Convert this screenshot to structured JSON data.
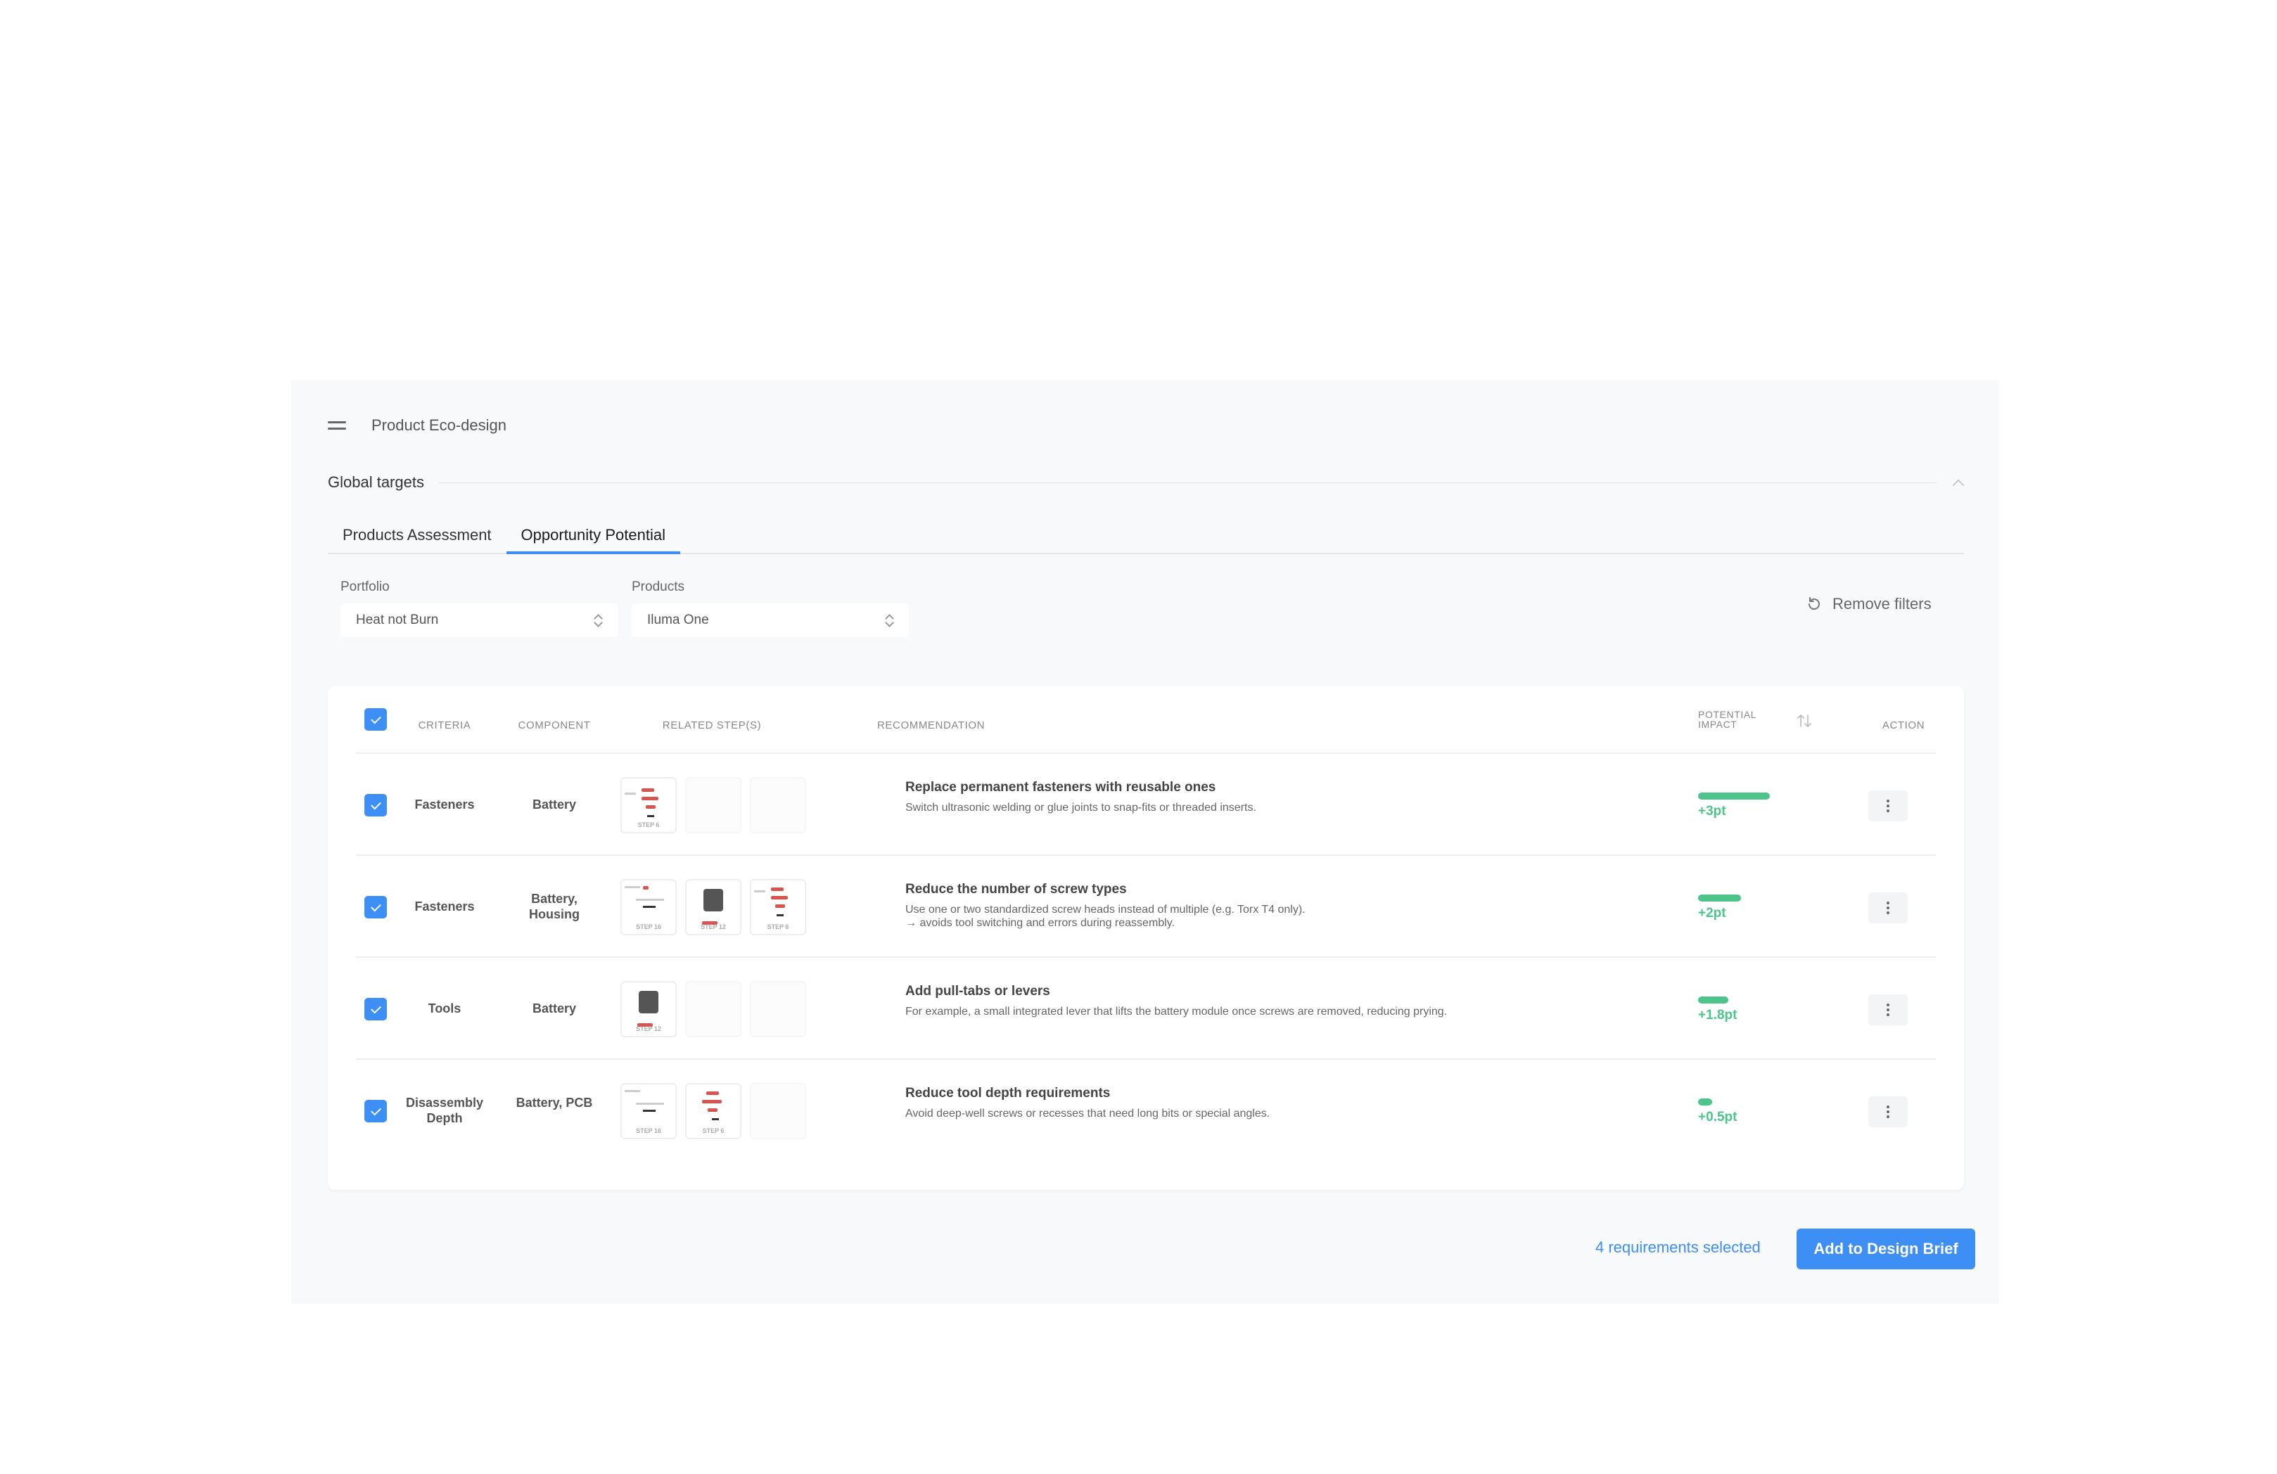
{
  "app": {
    "title": "Product Eco-design",
    "menu_icon": "hamburger-icon"
  },
  "section": {
    "title": "Global targets"
  },
  "tabs": [
    {
      "label": "Products Assessment",
      "active": false
    },
    {
      "label": "Opportunity Potential",
      "active": true
    }
  ],
  "filters": {
    "portfolio": {
      "label": "Portfolio",
      "value": "Heat not Burn"
    },
    "products": {
      "label": "Products",
      "value": "Iluma One"
    },
    "remove_label": "Remove filters"
  },
  "table": {
    "headers": {
      "criteria": "CRITERIA",
      "component": "COMPONENT",
      "steps": "RELATED STEP(S)",
      "recommendation": "RECOMMENDATION",
      "impact_line1": "POTENTIAL",
      "impact_line2": "IMPACT",
      "action": "ACTION"
    },
    "rows": [
      {
        "criteria": "Fasteners",
        "component": "Battery",
        "steps": [
          "STEP 6"
        ],
        "title": "Replace permanent fasteners with reusable ones",
        "desc1": "Switch ultrasonic welding or glue joints to snap-fits or threaded inserts.",
        "desc2": "",
        "impact": "+3pt",
        "impact_fraction": 1.0
      },
      {
        "criteria": "Fasteners",
        "component": "Battery, Housing",
        "steps": [
          "STEP 16",
          "STEP 12",
          "STEP 6"
        ],
        "title": "Reduce the number of screw types",
        "desc1": "Use one or two standardized screw heads instead of multiple (e.g. Torx T4 only).",
        "desc2": "→ avoids tool switching and errors during reassembly.",
        "impact": "+2pt",
        "impact_fraction": 0.6
      },
      {
        "criteria": "Tools",
        "component": "Battery",
        "steps": [
          "STEP 12"
        ],
        "title": "Add pull-tabs or levers",
        "desc1": "For example, a small integrated lever that lifts the battery module once screws are removed, reducing prying.",
        "desc2": "",
        "impact": "+1.8pt",
        "impact_fraction": 0.42
      },
      {
        "criteria": "Disassembly Depth",
        "component": "Battery, PCB",
        "steps": [
          "STEP 16",
          "STEP 6"
        ],
        "title": "Reduce tool depth requirements",
        "desc1": "Avoid deep-well screws or recesses that need long bits or special angles.",
        "desc2": "",
        "impact": "+0.5pt",
        "impact_fraction": 0.2
      }
    ]
  },
  "footer": {
    "selected_text": "4 requirements selected",
    "primary_label": "Add to Design Brief"
  },
  "colors": {
    "accent": "#3d8ef5",
    "impact": "#4cc48a",
    "panel_bg": "#f8f9fa"
  }
}
